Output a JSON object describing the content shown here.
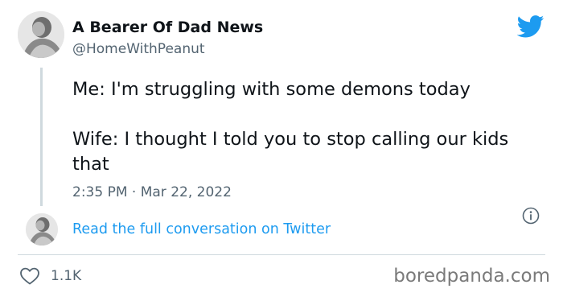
{
  "author": {
    "display_name": "A Bearer Of Dad News",
    "handle": "@HomeWithPeanut"
  },
  "tweet": {
    "lines": [
      "Me: I'm struggling with some demons today",
      "Wife: I thought I told you to stop calling our kids that"
    ],
    "timestamp": "2:35 PM · Mar 22, 2022"
  },
  "conversation_link": "Read the full conversation on Twitter",
  "engagement": {
    "likes": "1.1K"
  },
  "watermark": "boredpanda.com",
  "colors": {
    "twitter_blue": "#1d9bf0",
    "text_primary": "#0f1419",
    "text_secondary": "#536471",
    "divider": "#cfd9de"
  },
  "icons": {
    "brand": "twitter-bird-icon",
    "info": "info-icon",
    "like": "heart-icon"
  }
}
